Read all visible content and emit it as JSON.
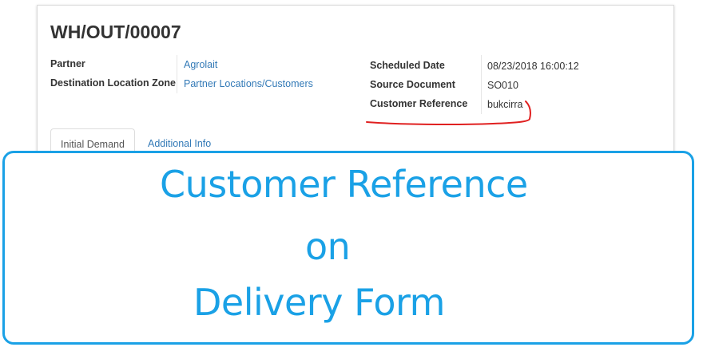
{
  "form": {
    "title": "WH/OUT/00007",
    "partner_label": "Partner",
    "partner_value": "Agrolait",
    "destination_label": "Destination Location Zone",
    "destination_value": "Partner Locations/Customers",
    "scheduled_date_label": "Scheduled Date",
    "scheduled_date_value": "08/23/2018 16:00:12",
    "source_document_label": "Source Document",
    "source_document_value": "SO010",
    "customer_reference_label": "Customer Reference",
    "customer_reference_value": "bukcirra"
  },
  "tabs": [
    "Initial Demand",
    "Additional Info"
  ],
  "annotation_color": "#e02020",
  "overlay": {
    "line1": "Customer Reference",
    "line2": "on",
    "line3": "Delivery Form",
    "color": "#1aa1e6"
  }
}
